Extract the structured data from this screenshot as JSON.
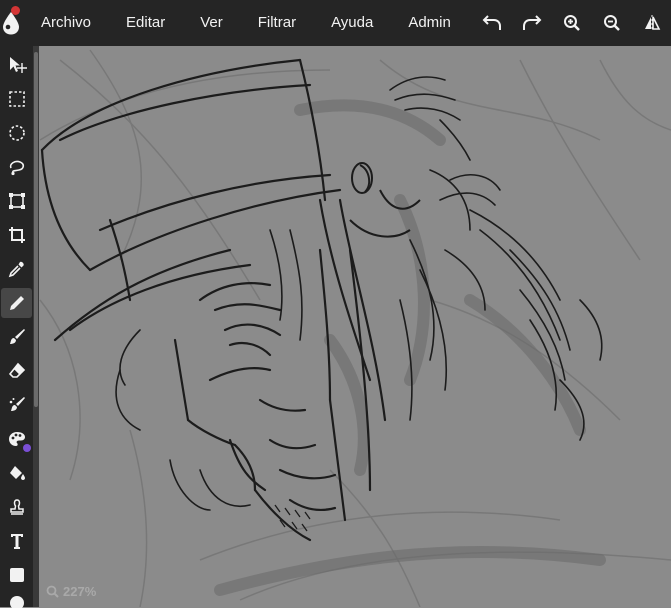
{
  "menu": {
    "items": [
      "Archivo",
      "Editar",
      "Ver",
      "Filtrar",
      "Ayuda",
      "Admin"
    ]
  },
  "toolbar_icons": [
    "move-icon",
    "rect-select-icon",
    "ellipse-select-icon",
    "lasso-icon",
    "transform-icon",
    "crop-icon",
    "eyedropper-icon",
    "pencil-icon",
    "brush-icon",
    "eraser-icon",
    "smudge-icon",
    "color-palette-icon",
    "fill-bucket-icon",
    "stamp-icon",
    "text-icon",
    "shape-icon"
  ],
  "active_tool": "pencil-icon",
  "colors": {
    "accent_notification": "#d33535",
    "palette_dot": "#7b4fd6",
    "menubar": "#252525"
  },
  "zoom": {
    "level": "227%"
  }
}
